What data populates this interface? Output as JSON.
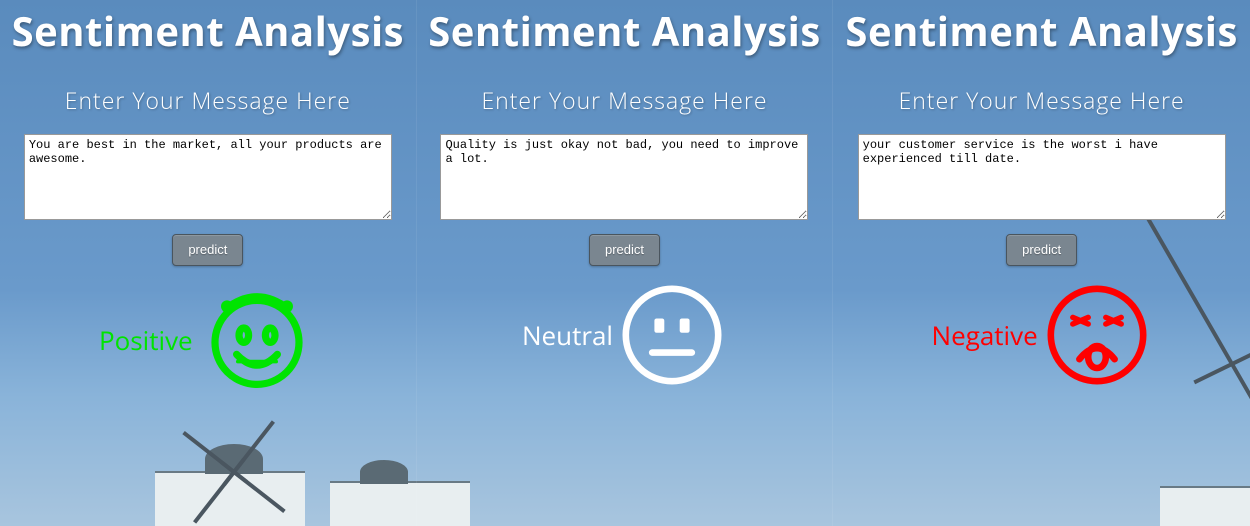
{
  "panels": [
    {
      "title": "Sentiment Analysis",
      "subtitle": "Enter Your Message Here",
      "message": "You are best in the market, all your products are awesome.",
      "predict_label": "predict",
      "result_label": "Positive",
      "result_sentiment": "positive",
      "result_color": "#00e400"
    },
    {
      "title": "Sentiment Analysis",
      "subtitle": "Enter Your Message Here",
      "message": "Quality is just okay not bad, you need to improve a lot.",
      "predict_label": "predict",
      "result_label": "Neutral",
      "result_sentiment": "neutral",
      "result_color": "#ffffff"
    },
    {
      "title": "Sentiment Analysis",
      "subtitle": "Enter Your Message Here",
      "message": "your customer service is the worst i have experienced till date.",
      "predict_label": "predict",
      "result_label": "Negative",
      "result_sentiment": "negative",
      "result_color": "#ff0000"
    }
  ]
}
